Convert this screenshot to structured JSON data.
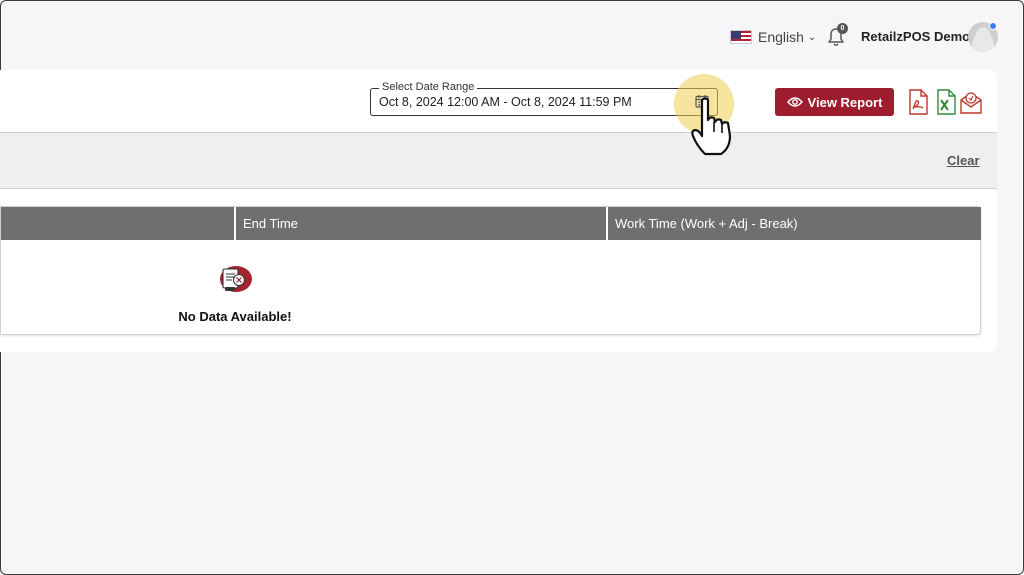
{
  "header": {
    "language": "English",
    "notification_count": "0",
    "user_name": "RetailzPOS Demo"
  },
  "report": {
    "date_range_label": "Select Date Range",
    "date_range_value": "Oct 8, 2024 12:00 AM - Oct 8, 2024 11:59 PM",
    "view_report_label": "View Report",
    "clear_label": "Clear"
  },
  "table": {
    "columns": [
      "End Time",
      "Work Time (Work + Adj - Break)"
    ],
    "empty_message": "No Data Available!"
  },
  "icons": {
    "calendar": "calendar-icon",
    "eye": "eye-icon",
    "pdf": "pdf-export-icon",
    "excel": "excel-export-icon",
    "email": "email-export-icon",
    "bell": "bell-icon",
    "cursor": "hand-pointer-icon"
  },
  "colors": {
    "accent": "#9d1c2e",
    "table_header": "#6f6f6f",
    "highlight": "#f0cd50",
    "excel_green": "#2e8b3a",
    "pdf_red": "#c0392b"
  }
}
